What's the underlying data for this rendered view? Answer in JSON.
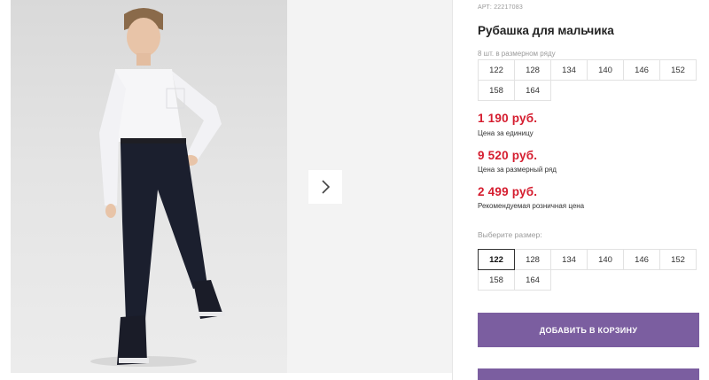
{
  "product": {
    "sku": "АРТ: 22217083",
    "title": "Рубашка для мальчика"
  },
  "pack": {
    "note": "8 шт. в размерном ряду",
    "sizes": [
      "122",
      "128",
      "134",
      "140",
      "146",
      "152",
      "158",
      "164"
    ]
  },
  "prices": {
    "unit_price": "1 190 руб.",
    "unit_label": "Цена за единицу",
    "pack_price": "9 520 руб.",
    "pack_label": "Цена за размерный ряд",
    "retail_price": "2 499 руб.",
    "retail_label": "Рекомендуемая розничная цена"
  },
  "size_select": {
    "label": "Выберите размер:",
    "options": [
      "122",
      "128",
      "134",
      "140",
      "146",
      "152",
      "158",
      "164"
    ],
    "selected": "122"
  },
  "actions": {
    "add_to_cart": "ДОБАВИТЬ В КОРЗИНУ"
  },
  "icons": {
    "next": "chevron-right-icon"
  },
  "colors": {
    "price": "#d51d2f",
    "button": "#7b5ea0"
  }
}
